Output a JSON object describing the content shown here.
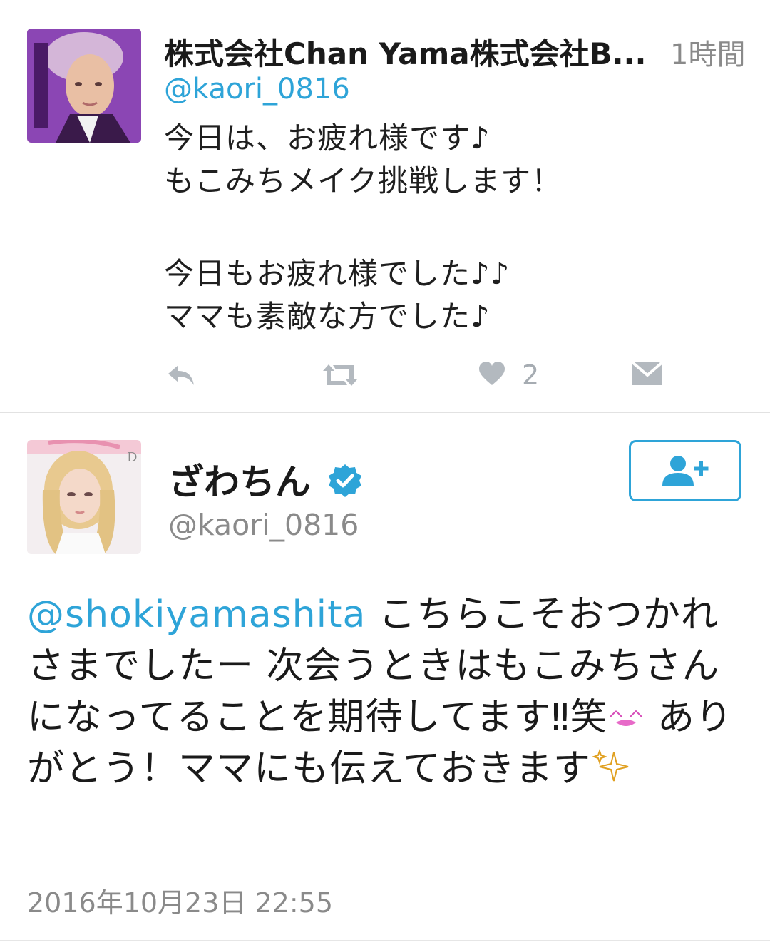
{
  "tweet1": {
    "author_name": "株式会社Chan Yama株式会社B...",
    "time": "1時間",
    "handle": "@kaori_0816",
    "lines": [
      "今日は、お疲れ様です♪",
      "もこみちメイク挑戦します！",
      "",
      "今日もお疲れ様でした♪♪",
      "ママも素敵な方でした♪"
    ],
    "like_count": "2",
    "icons": {
      "reply": "reply-icon",
      "retweet": "retweet-icon",
      "like": "heart-icon",
      "dm": "envelope-icon"
    }
  },
  "tweet2": {
    "author_name": "ざわちん",
    "verified_icon": "verified-badge-icon",
    "handle": "@kaori_0816",
    "follow_icon": "add-user-icon",
    "mention": "@shokiyamashita",
    "text_part1": " こちらこそおつかれさまでしたー 次会うときはもこみちさんになってることを期待してます‼笑",
    "text_part2": " ありがとう！ママにも伝えておきます",
    "date": "2016年10月23日 22:55"
  },
  "colors": {
    "link_blue": "#2ea4d8",
    "meta_gray": "#8a8a8a",
    "icon_gray": "#b3b9bf",
    "divider": "#e2e2e2"
  }
}
